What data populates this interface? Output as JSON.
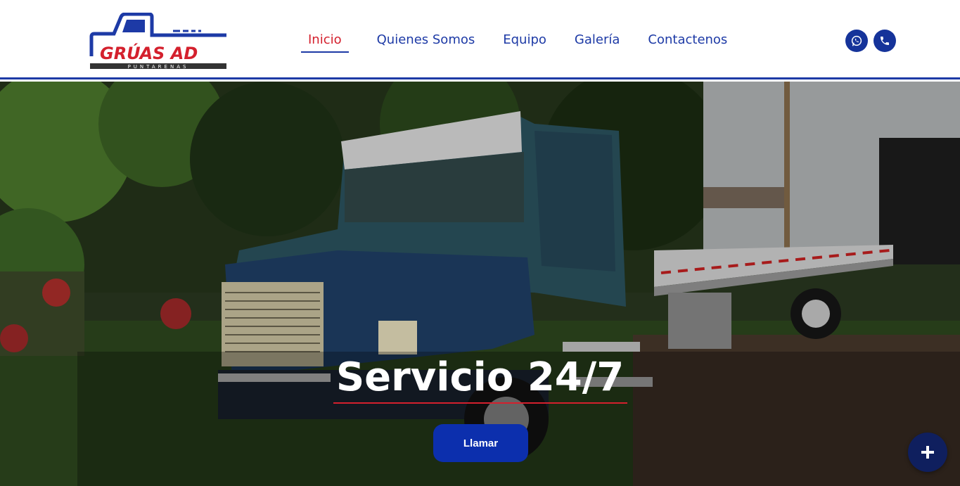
{
  "brand": {
    "logo_text": "GRÚAS AD",
    "logo_subtext": "PUNTARENAS"
  },
  "nav": {
    "items": [
      {
        "label": "Inicio",
        "active": true
      },
      {
        "label": "Quienes Somos",
        "active": false
      },
      {
        "label": "Equipo",
        "active": false
      },
      {
        "label": "Galería",
        "active": false
      },
      {
        "label": "Contactenos",
        "active": false
      }
    ]
  },
  "social": {
    "icons": [
      "whatsapp-icon",
      "phone-icon"
    ]
  },
  "hero": {
    "title": "Servicio 24/7",
    "cta_label": "Llamar"
  },
  "fab": {
    "icon": "plus-icon"
  },
  "colors": {
    "primary_blue": "#1d3aa6",
    "accent_red": "#d4202d",
    "cta_blue": "#0c2fad",
    "fab_navy": "#0f1f5e"
  }
}
